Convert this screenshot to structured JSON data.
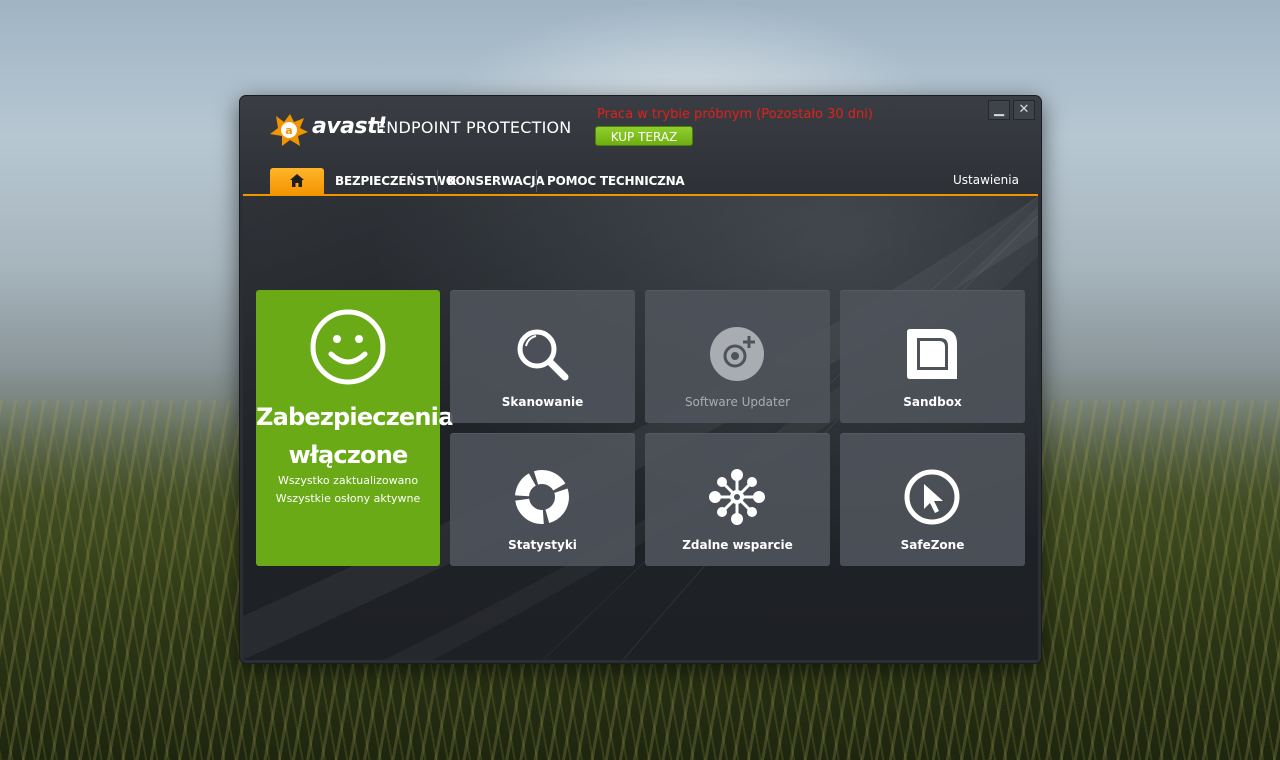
{
  "app": {
    "brand": "avast!",
    "product": "ENDPOINT PROTECTION",
    "trial_notice": "Praca w trybie próbnym (Pozostało 30 dni)",
    "buy_label": "KUP TERAZ",
    "window_controls": {
      "minimize": "▁",
      "close": "✕"
    }
  },
  "nav": {
    "home_icon": "home-icon",
    "items": [
      {
        "label": "BEZPIECZEŃSTWO"
      },
      {
        "label": "KONSERWACJA"
      },
      {
        "label": "POMOC TECHNICZNA"
      }
    ],
    "settings_label": "Ustawienia"
  },
  "status": {
    "icon": "smiley-icon",
    "title_line1": "Zabezpieczenia",
    "title_line2": "włączone",
    "sub1": "Wszystko zaktualizowano",
    "sub2": "Wszystkie osłony aktywne"
  },
  "tiles": [
    {
      "label": "Skanowanie",
      "icon": "magnifier-icon",
      "enabled": true
    },
    {
      "label": "Software Updater",
      "icon": "software-updater-icon",
      "enabled": false
    },
    {
      "label": "Sandbox",
      "icon": "sandbox-icon",
      "enabled": true
    },
    {
      "label": "Statystyki",
      "icon": "chart-icon",
      "enabled": true
    },
    {
      "label": "Zdalne wsparcie",
      "icon": "network-icon",
      "enabled": true
    },
    {
      "label": "SafeZone",
      "icon": "cursor-icon",
      "enabled": true
    }
  ],
  "colors": {
    "accent": "#f29400",
    "status_green": "#6aaa16",
    "buy_green": "#7fbf20",
    "trial_red": "#e0201a"
  }
}
